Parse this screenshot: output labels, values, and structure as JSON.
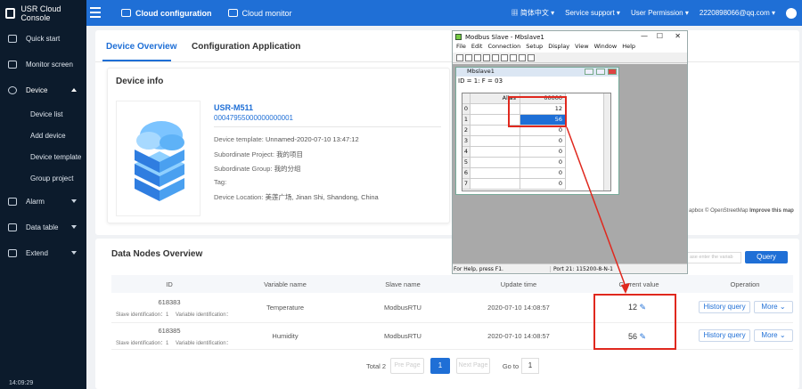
{
  "topbar": {
    "brand": "USR Cloud Console",
    "nav": [
      {
        "label": "Cloud configuration"
      },
      {
        "label": "Cloud monitor"
      }
    ],
    "language": "简体中文",
    "support": "Service support",
    "permission": "User Permission",
    "email": "2220898066@qq.com"
  },
  "sidebar": {
    "items": [
      {
        "label": "Quick start"
      },
      {
        "label": "Monitor screen"
      },
      {
        "label": "Device"
      },
      {
        "label": "Device list"
      },
      {
        "label": "Add device"
      },
      {
        "label": "Device template"
      },
      {
        "label": "Group project"
      },
      {
        "label": "Alarm"
      },
      {
        "label": "Data table"
      },
      {
        "label": "Extend"
      }
    ],
    "time": "14:09:29"
  },
  "tabs": [
    {
      "label": "Device Overview"
    },
    {
      "label": "Configuration Application"
    }
  ],
  "device": {
    "section": "Device info",
    "name": "USR-M511",
    "sn": "00047955000000000001",
    "template_label": "Device template:",
    "template": "Unnamed-2020-07-10 13:47:12",
    "project_label": "Subordinate Project:",
    "project": "我的项目",
    "group_label": "Subordinate Group:",
    "group": "我的分组",
    "tag_label": "Tag:",
    "location_label": "Device Location:",
    "location": "美莲广场, Jinan Shi, Shandong, China"
  },
  "map": {
    "attribution": "apbox © OpenStreetMap",
    "improve": "Improve this map"
  },
  "nodes": {
    "section": "Data Nodes Overview",
    "search_placeholder": "ase enter the variab",
    "query": "Query",
    "headers": {
      "id": "ID",
      "variable": "Variable name",
      "slave": "Slave name",
      "update": "Update time",
      "current": "Current value",
      "operation": "Operation"
    },
    "rows": [
      {
        "id": "618383",
        "slave_id": "Slave identification：1",
        "var_id": "Variable identification：",
        "variable": "Temperature",
        "slave": "ModbusRTU",
        "time": "2020-07-10 14:08:57",
        "value": "12",
        "history": "History query",
        "more": "More"
      },
      {
        "id": "618385",
        "slave_id": "Slave identification：1",
        "var_id": "Variable identification：",
        "variable": "Humidity",
        "slave": "ModbusRTU",
        "time": "2020-07-10 14:08:57",
        "value": "56",
        "history": "History query",
        "more": "More"
      }
    ],
    "pagination": {
      "total": "Total 2",
      "prev": "Pre Page",
      "page": "1",
      "next": "Next Page",
      "goto": "Go to",
      "goto_value": "1"
    }
  },
  "modbus": {
    "title": "Modbus Slave - Mbslave1",
    "menu": [
      "File",
      "Edit",
      "Connection",
      "Setup",
      "Display",
      "View",
      "Window",
      "Help"
    ],
    "child_title": "Mbslave1",
    "id_line": "ID = 1: F = 03",
    "col_alias": "Alias",
    "col_addr": "00000",
    "rows": [
      {
        "n": "0",
        "v": "12"
      },
      {
        "n": "1",
        "v": "56"
      },
      {
        "n": "2",
        "v": "0"
      },
      {
        "n": "3",
        "v": "0"
      },
      {
        "n": "4",
        "v": "0"
      },
      {
        "n": "5",
        "v": "0"
      },
      {
        "n": "6",
        "v": "0"
      },
      {
        "n": "7",
        "v": "0"
      }
    ],
    "status_left": "For Help, press F1.",
    "status_right": "Port 21: 115200-8-N-1"
  }
}
